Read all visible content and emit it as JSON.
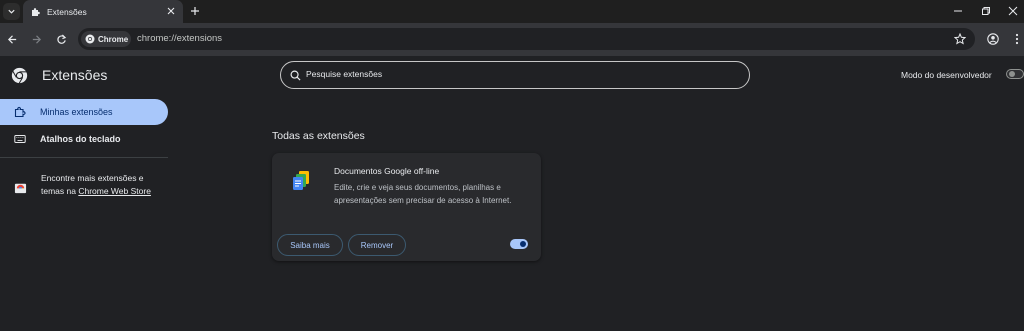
{
  "tabstrip": {
    "tab_title": "Extensões"
  },
  "toolbar": {
    "chip_label": "Chrome",
    "url": "chrome://extensions"
  },
  "header": {
    "title": "Extensões",
    "search_placeholder": "Pesquise extensões",
    "devmode_label": "Modo do desenvolvedor",
    "devmode_enabled": false
  },
  "sidebar": {
    "items": [
      {
        "label": "Minhas extensões",
        "selected": true
      },
      {
        "label": "Atalhos do teclado",
        "selected": false
      }
    ],
    "more_text_prefix": "Encontre mais extensões e temas na ",
    "more_link": "Chrome Web Store"
  },
  "main": {
    "section_title": "Todas as extensões",
    "extensions": [
      {
        "name": "Documentos Google off-line",
        "description": "Edite, crie e veja seus documentos, planilhas e apresentações sem precisar de acesso à Internet.",
        "details_label": "Saiba mais",
        "remove_label": "Remover",
        "enabled": true
      }
    ]
  },
  "colors": {
    "accent": "#a8c7fa",
    "background": "#202124",
    "card": "#292a2d",
    "toolbar": "#35363a"
  }
}
